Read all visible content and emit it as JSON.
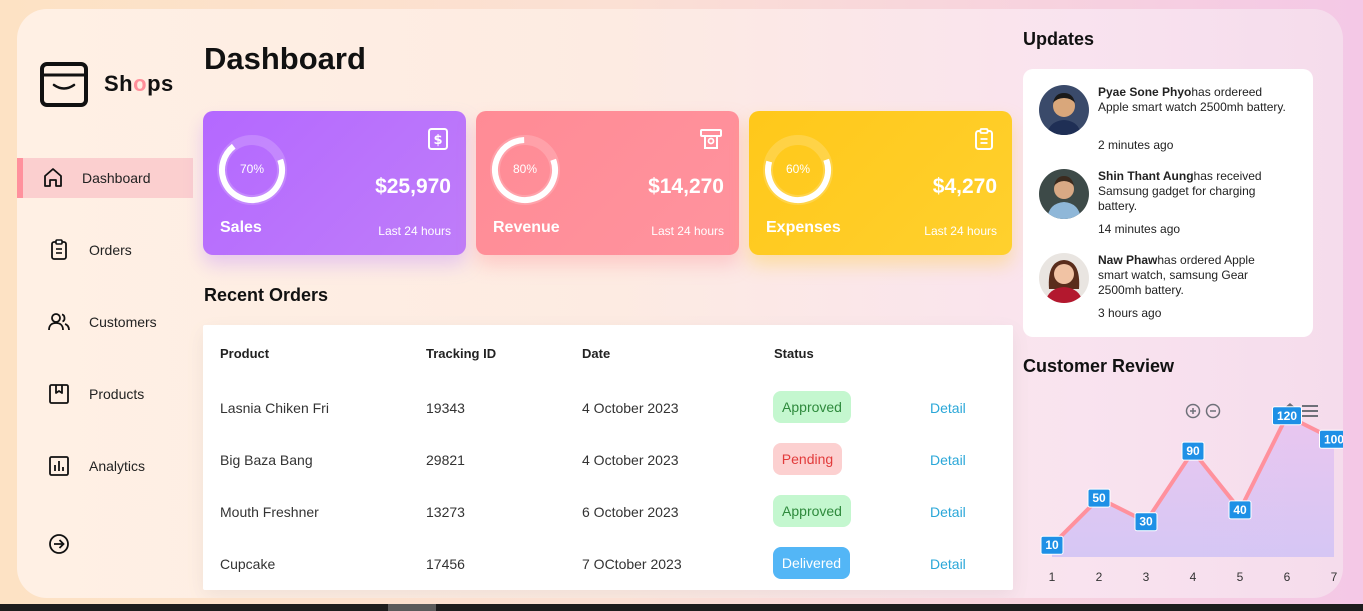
{
  "brand": {
    "name_prefix": "Sh",
    "name_accent": "o",
    "name_suffix": "ps"
  },
  "menu": [
    {
      "label": "Dashboard",
      "icon": "home-icon",
      "active": true
    },
    {
      "label": "Orders",
      "icon": "clipboard-icon"
    },
    {
      "label": "Customers",
      "icon": "users-icon"
    },
    {
      "label": "Products",
      "icon": "package-icon"
    },
    {
      "label": "Analytics",
      "icon": "bar-chart-icon"
    }
  ],
  "logout_icon": "sign-out-icon",
  "page_title": "Dashboard",
  "cards": [
    {
      "label": "Sales",
      "amount": "$25,970",
      "percent": 70,
      "percent_label": "70%",
      "sub": "Last 24 hours",
      "icon": "dollar-icon",
      "color": "#b468ff"
    },
    {
      "label": "Revenue",
      "amount": "$14,270",
      "percent": 80,
      "percent_label": "80%",
      "sub": "Last 24 hours",
      "icon": "money-icon",
      "color": "#ff8b95"
    },
    {
      "label": "Expenses",
      "amount": "$4,270",
      "percent": 60,
      "percent_label": "60%",
      "sub": "Last 24 hours",
      "icon": "clipboard-icon",
      "color": "#ffc81a"
    }
  ],
  "recent_orders": {
    "title": "Recent Orders",
    "headers": [
      "Product",
      "Tracking ID",
      "Date",
      "Status"
    ],
    "rows": [
      {
        "product": "Lasnia Chiken Fri",
        "tracking": "19343",
        "date": "4 October 2023",
        "status": "Approved",
        "detail": "Detail"
      },
      {
        "product": "Big Baza Bang",
        "tracking": "29821",
        "date": "4 October 2023",
        "status": "Pending",
        "detail": "Detail"
      },
      {
        "product": "Mouth Freshner",
        "tracking": "13273",
        "date": "6 October 2023",
        "status": "Approved",
        "detail": "Detail"
      },
      {
        "product": "Cupcake",
        "tracking": "17456",
        "date": "7 OCtober 2023",
        "status": "Delivered",
        "detail": "Detail"
      }
    ]
  },
  "status_colors": {
    "Approved": "#c4f7cf",
    "Pending": "#fcd0d0",
    "Delivered": "#53b6f6"
  },
  "updates": {
    "title": "Updates",
    "items": [
      {
        "name": "Pyae Sone Phyo",
        "text": "has ordereed Apple smart watch 2500mh battery.",
        "time": "2 minutes ago"
      },
      {
        "name": "Shin Thant Aung",
        "text": "has received Samsung gadget for charging battery.",
        "time": "14 minutes ago"
      },
      {
        "name": "Naw Phaw",
        "text": "has ordered Apple smart watch, samsung Gear 2500mh battery.",
        "time": "3 hours ago"
      }
    ]
  },
  "review": {
    "title": "Customer Review",
    "toolbar": [
      "zoom-in-icon",
      "zoom-out-icon",
      "home-icon",
      "menu-icon"
    ]
  },
  "chart_data": {
    "type": "area",
    "x": [
      1,
      2,
      3,
      4,
      5,
      6,
      7
    ],
    "tick_labels": [
      "1",
      "2",
      "3",
      "4",
      "5",
      "6",
      "7"
    ],
    "series": [
      {
        "values": [
          10,
          50,
          30,
          90,
          40,
          120,
          100
        ]
      }
    ],
    "data_labels": [
      "10",
      "50",
      "30",
      "90",
      "40",
      "120",
      "100"
    ],
    "ylim": [
      0,
      130
    ],
    "grid": false,
    "line_color": "#ff919d",
    "label_color": "#1e90e6"
  }
}
